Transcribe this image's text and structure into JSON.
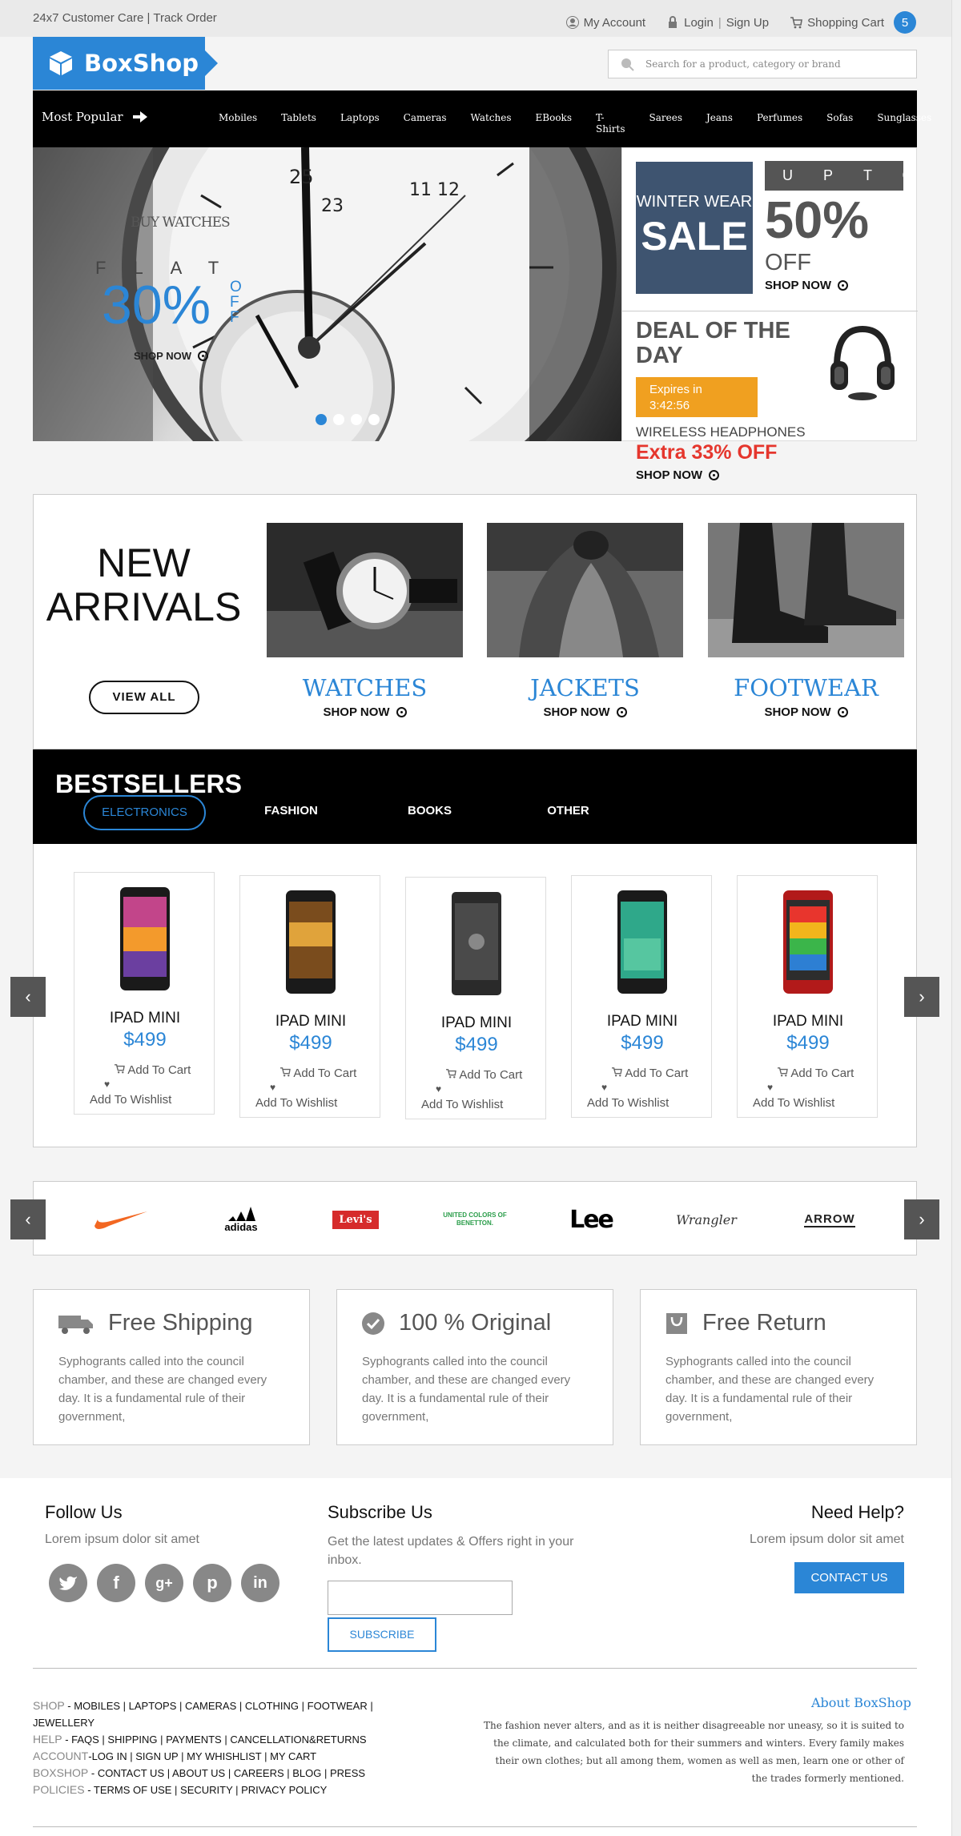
{
  "topbar": {
    "left": "24x7 Customer Care | Track Order",
    "my_account": "My Account",
    "login": "Login",
    "signup": "Sign Up",
    "cart": "Shopping Cart",
    "cart_count": "5"
  },
  "logo": "BoxShop",
  "search": {
    "placeholder": "Search for a product, category or brand"
  },
  "nav": {
    "popular": "Most Popular",
    "items": [
      "Mobiles",
      "Tablets",
      "Laptops",
      "Cameras",
      "Watches",
      "EBooks",
      "T-Shirts",
      "Sarees",
      "Jeans",
      "Perfumes",
      "Sofas",
      "Sunglasses"
    ]
  },
  "hero": {
    "buy": "BUY WATCHES",
    "flat": "FLAT",
    "percent": "30%",
    "off": "OFF",
    "shop": "SHOP NOW"
  },
  "promo": {
    "winter": "WINTER WEAR",
    "sale": "SALE",
    "upto": "UPTO",
    "fifty": "50%",
    "off": "OFF",
    "shop": "SHOP NOW",
    "deal": "DEAL OF THE DAY",
    "expires": "Expires in",
    "time": "3:42:56",
    "product": "WIRELESS HEADPHONES",
    "extra": "Extra 33% OFF",
    "shop2": "SHOP NOW"
  },
  "arrivals": {
    "title1": "NEW",
    "title2": "ARRIVALS",
    "view_all": "VIEW ALL",
    "cats": [
      {
        "name": "WATCHES",
        "shop": "SHOP NOW"
      },
      {
        "name": "JACKETS",
        "shop": "SHOP NOW"
      },
      {
        "name": "FOOTWEAR",
        "shop": "SHOP NOW"
      }
    ]
  },
  "bestsellers": {
    "title": "BESTSELLERS",
    "tabs": [
      "ELECTRONICS",
      "FASHION",
      "BOOKS",
      "OTHER"
    ],
    "products": [
      {
        "name": "IPAD MINI",
        "price": "$499",
        "cart": "Add To Cart",
        "wish": "Add To Wishlist"
      },
      {
        "name": "IPAD MINI",
        "price": "$499",
        "cart": "Add To Cart",
        "wish": "Add To Wishlist"
      },
      {
        "name": "IPAD MINI",
        "price": "$499",
        "cart": "Add To Cart",
        "wish": "Add To Wishlist"
      },
      {
        "name": "IPAD MINI",
        "price": "$499",
        "cart": "Add To Cart",
        "wish": "Add To Wishlist"
      },
      {
        "name": "IPAD MINI",
        "price": "$499",
        "cart": "Add To Cart",
        "wish": "Add To Wishlist"
      }
    ]
  },
  "brands": [
    "adidas",
    "Levi's",
    "UNITED COLORS OF BENETTON.",
    "Lee",
    "Wrangler",
    "ARROW"
  ],
  "features": [
    {
      "title": "Free Shipping",
      "desc": "Syphogrants called into the council chamber, and these are changed every day. It is a fundamental rule of their government,"
    },
    {
      "title": "100 % Original",
      "desc": "Syphogrants called into the council chamber, and these are changed every day. It is a fundamental rule of their government,"
    },
    {
      "title": "Free Return",
      "desc": "Syphogrants called into the council chamber, and these are changed every day. It is a fundamental rule of their government,"
    }
  ],
  "footer": {
    "follow": "Follow Us",
    "follow_sub": "Lorem ipsum dolor sit amet",
    "subscribe": "Subscribe Us",
    "subscribe_sub": "Get the latest updates & Offers right in your inbox.",
    "subscribe_btn": "SUBSCRIBE",
    "help": "Need Help?",
    "help_sub": "Lorem ipsum dolor sit amet",
    "contact_btn": "CONTACT US",
    "links": [
      {
        "key": "SHOP",
        "items": "MOBILES | LAPTOPS | CAMERAS | CLOTHING | FOOTWEAR | JEWELLERY"
      },
      {
        "key": "HELP",
        "items": "FAQS | SHIPPING | PAYMENTS | CANCELLATION&RETURNS"
      },
      {
        "key": "ACCOUNT",
        "items": "LOG IN | SIGN UP | MY WHISHLIST | MY CART"
      },
      {
        "key": "BOXSHOP",
        "items": "CONTACT US | ABOUT US | CAREERS | BLOG | PRESS"
      },
      {
        "key": "POLICIES",
        "items": "TERMS OF USE | SECURITY | PRIVACY POLICY"
      }
    ],
    "about_title": "About BoxShop",
    "about_text": "The fashion never alters, and as it is neither disagreeable nor uneasy, so it is suited to the climate, and calculated both for their summers and winters. Every family makes their own clothes; but all among them, women as well as men, learn one or other of the trades formerly mentioned."
  }
}
